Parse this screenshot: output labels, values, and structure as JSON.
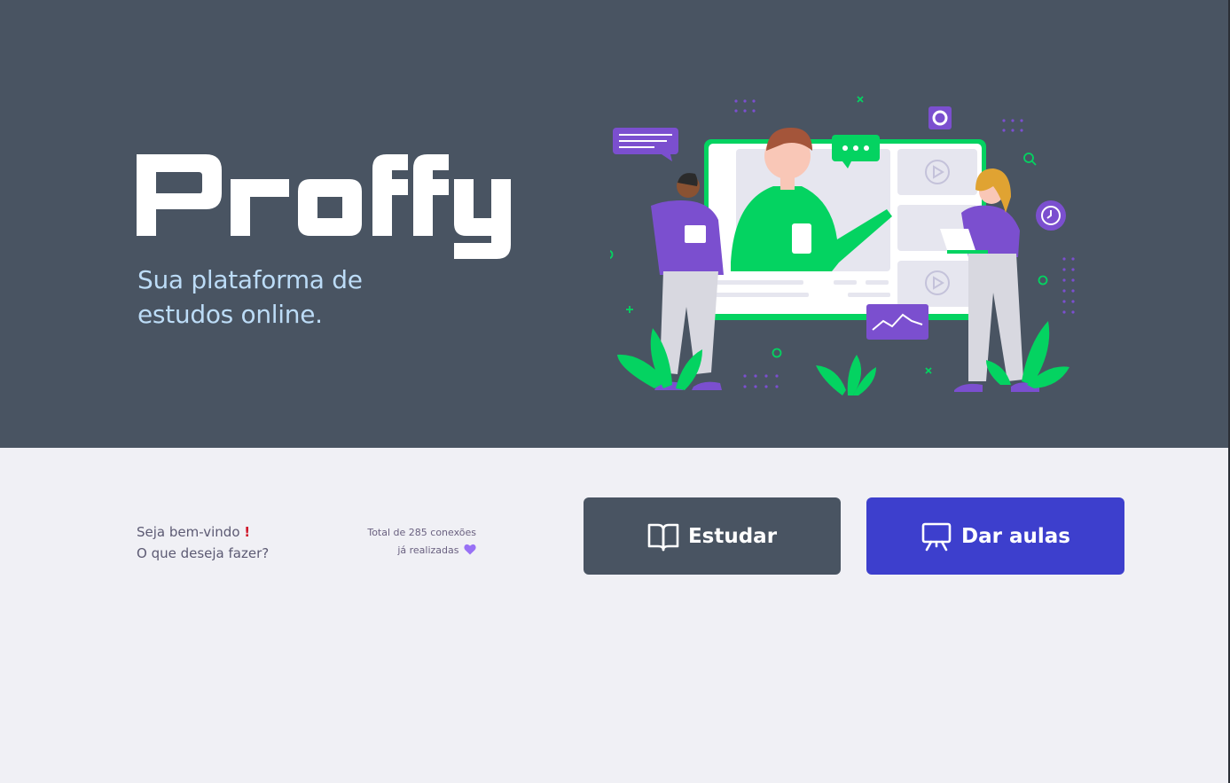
{
  "brand": {
    "logo_text": "Proffy",
    "tagline": "Sua plataforma de estudos online."
  },
  "welcome": {
    "line1": "Seja bem-vindo",
    "line1_mark": "!",
    "line2": "O que deseja fazer?"
  },
  "connections": {
    "line1": "Total de 285 conexões",
    "line2": "já realizadas"
  },
  "actions": {
    "study_label": "Estudar",
    "teach_label": "Dar aulas"
  },
  "icons": {
    "study": "book-open-icon",
    "teach": "presentation-icon",
    "heart": "purple-heart-icon"
  },
  "colors": {
    "hero_bg": "#495462",
    "page_bg": "#f0f0f5",
    "tagline": "#bcdcf7",
    "study_button": "#495462",
    "teach_button": "#3d3fcd",
    "accent_green": "#04d361",
    "accent_purple": "#7b4fcf"
  }
}
